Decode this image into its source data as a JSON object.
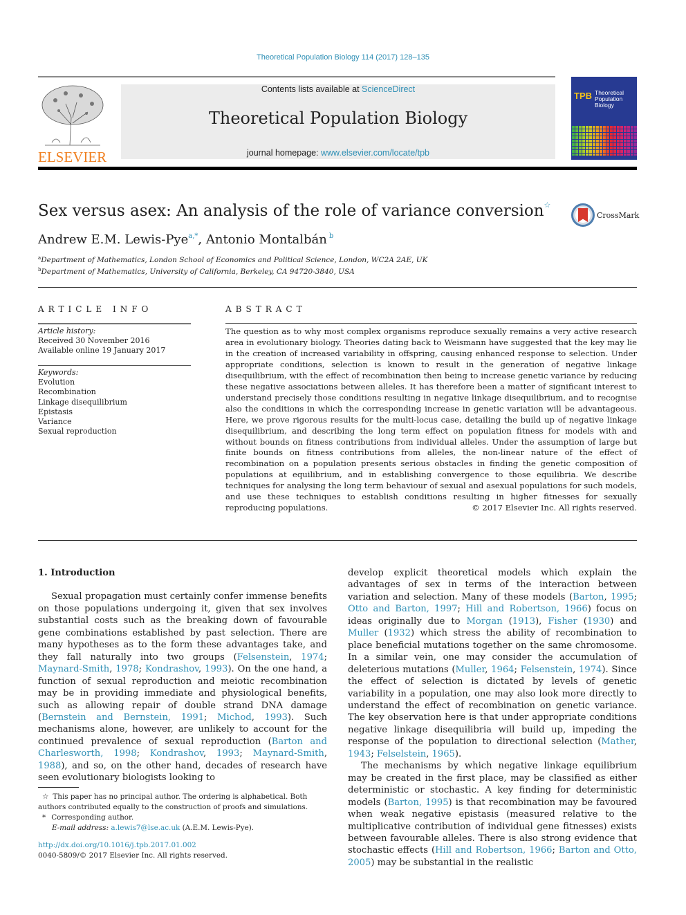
{
  "header": {
    "citation": "Theoretical Population Biology 114 (2017) 128–135",
    "contents_prefix": "Contents lists available at ",
    "contents_link": "ScienceDirect",
    "journal_title": "Theoretical Population Biology",
    "homepage_prefix": "journal homepage: ",
    "homepage_link": "www.elsevier.com/locate/tpb",
    "publisher_logo_text": "ELSEVIER",
    "cover": {
      "abbrev": "TPB",
      "title_lines": [
        "Theoretical",
        "Population",
        "Biology"
      ]
    }
  },
  "article": {
    "title": "Sex versus asex: An analysis of the role of variance conversion",
    "title_note_mark": "☆",
    "crossmark_label": "CrossMark",
    "authors": [
      {
        "name": "Andrew E.M. Lewis-Pye",
        "marks": "a,*"
      },
      {
        "name": "Antonio Montalbán",
        "marks": "b"
      }
    ],
    "author_separator": ", ",
    "affiliations": [
      {
        "mark": "a",
        "text": "Department of Mathematics, London School of Economics and Political Science, London, WC2A 2AE, UK"
      },
      {
        "mark": "b",
        "text": "Department of Mathematics, University of California, Berkeley, CA 94720-3840, USA"
      }
    ]
  },
  "article_info": {
    "heading": "ARTICLE INFO",
    "history_label": "Article history:",
    "history": [
      "Received 30 November 2016",
      "Available online 19 January 2017"
    ],
    "keywords_label": "Keywords:",
    "keywords": [
      "Evolution",
      "Recombination",
      "Linkage disequilibrium",
      "Epistasis",
      "Variance",
      "Sexual reproduction"
    ]
  },
  "abstract": {
    "heading": "ABSTRACT",
    "text": "The question as to why most complex organisms reproduce sexually remains a very active research area in evolutionary biology. Theories dating back to Weismann have suggested that the key may lie in the creation of increased variability in offspring, causing enhanced response to selection. Under appropriate conditions, selection is known to result in the generation of negative linkage disequilibrium, with the effect of recombination then being to increase genetic variance by reducing these negative associations between alleles. It has therefore been a matter of significant interest to understand precisely those conditions resulting in negative linkage disequilibrium, and to recognise also the conditions in which the corresponding increase in genetic variation will be advantageous. Here, we prove rigorous results for the multi-locus case, detailing the build up of negative linkage disequilibrium, and describing the long term effect on population fitness for models with and without bounds on fitness contributions from individual alleles. Under the assumption of large but finite bounds on fitness contributions from alleles, the non-linear nature of the effect of recombination on a population presents serious obstacles in finding the genetic composition of populations at equilibrium, and in establishing convergence to those equilibria. We describe techniques for analysing the long term behaviour of sexual and asexual populations for such models, and use these techniques to establish conditions resulting in higher fitnesses for sexually reproducing populations.",
    "copyright": "© 2017 Elsevier Inc. All rights reserved."
  },
  "body": {
    "section_heading": "1.  Introduction",
    "left_paragraph": [
      {
        "t": "Sexual propagation must certainly confer immense benefits on those populations undergoing it, given that sex involves substantial costs such as the breaking down of favourable gene combinations established by past selection. There are many hypotheses as to the form these advantages take, and they fall naturally into two groups ("
      },
      {
        "l": "Felsenstein"
      },
      {
        "t": ", "
      },
      {
        "l": "1974"
      },
      {
        "t": "; "
      },
      {
        "l": "Maynard-Smith"
      },
      {
        "t": ", "
      },
      {
        "l": "1978"
      },
      {
        "t": "; "
      },
      {
        "l": "Kondrashov"
      },
      {
        "t": ", "
      },
      {
        "l": "1993"
      },
      {
        "t": "). On the one hand, a function of sexual reproduction and meiotic recombination may be in providing immediate and physiological benefits, such as allowing repair of double strand DNA damage ("
      },
      {
        "l": "Bernstein and Bernstein, 1991"
      },
      {
        "t": "; "
      },
      {
        "l": "Michod"
      },
      {
        "t": ", "
      },
      {
        "l": "1993"
      },
      {
        "t": "). Such mechanisms alone, however, are unlikely to account for the continued prevalence of sexual reproduction ("
      },
      {
        "l": "Barton and Charlesworth, 1998"
      },
      {
        "t": "; "
      },
      {
        "l": "Kondrashov"
      },
      {
        "t": ", "
      },
      {
        "l": "1993"
      },
      {
        "t": "; "
      },
      {
        "l": "Maynard-Smith"
      },
      {
        "t": ", "
      },
      {
        "l": "1988"
      },
      {
        "t": "), and so, on the other hand, decades of research have seen evolutionary biologists looking to"
      }
    ],
    "right_paragraph_1": [
      {
        "t": "develop explicit theoretical models which explain the advantages of sex in terms of the interaction between variation and selection. Many of these models ("
      },
      {
        "l": "Barton"
      },
      {
        "t": ", "
      },
      {
        "l": "1995"
      },
      {
        "t": "; "
      },
      {
        "l": "Otto and Barton, 1997"
      },
      {
        "t": "; "
      },
      {
        "l": "Hill and Robertson, 1966"
      },
      {
        "t": ") focus on ideas originally due to "
      },
      {
        "l": "Morgan"
      },
      {
        "t": " ("
      },
      {
        "l": "1913"
      },
      {
        "t": "), "
      },
      {
        "l": "Fisher"
      },
      {
        "t": " ("
      },
      {
        "l": "1930"
      },
      {
        "t": ") and "
      },
      {
        "l": "Muller"
      },
      {
        "t": " ("
      },
      {
        "l": "1932"
      },
      {
        "t": ") which stress the ability of recombination to place beneficial mutations together on the same chromosome. In a similar vein, one may consider the accumulation of deleterious mutations ("
      },
      {
        "l": "Muller"
      },
      {
        "t": ", "
      },
      {
        "l": "1964"
      },
      {
        "t": "; "
      },
      {
        "l": "Felsenstein"
      },
      {
        "t": ", "
      },
      {
        "l": "1974"
      },
      {
        "t": "). Since the effect of selection is dictated by levels of genetic variability in a population, one may also look more directly to understand the effect of recombination on genetic variance. The key observation here is that under appropriate conditions negative linkage disequilibria will build up, impeding the response of the population to directional selection ("
      },
      {
        "l": "Mather"
      },
      {
        "t": ", "
      },
      {
        "l": "1943"
      },
      {
        "t": "; "
      },
      {
        "l": "Felselstein"
      },
      {
        "t": ", "
      },
      {
        "l": "1965"
      },
      {
        "t": ")."
      }
    ],
    "right_paragraph_2": [
      {
        "t": "The mechanisms by which negative linkage equilibrium may be created in the first place, may be classified as either deterministic or stochastic. A key finding for deterministic models ("
      },
      {
        "l": "Barton, 1995"
      },
      {
        "t": ") is that recombination may be favoured when weak negative epistasis (measured relative to the multiplicative contribution of individual gene fitnesses) exists between favourable alleles. There is also strong evidence that stochastic effects ("
      },
      {
        "l": "Hill and Robertson, 1966"
      },
      {
        "t": "; "
      },
      {
        "l": "Barton and Otto, 2005"
      },
      {
        "t": ") may be substantial in the realistic"
      }
    ]
  },
  "footnotes": {
    "star_mark": "☆",
    "star_text": "This paper has no principal author. The ordering is alphabetical. Both authors contributed equally to the construction of proofs and simulations.",
    "corresponding_mark": "*",
    "corresponding_text": "Corresponding author.",
    "email_label": "E-mail address:",
    "email": "a.lewis7@lse.ac.uk",
    "email_suffix": " (A.E.M. Lewis-Pye).",
    "doi": "http://dx.doi.org/10.1016/j.tpb.2017.01.002",
    "issn_line": "0040-5809/© 2017 Elsevier Inc. All rights reserved."
  },
  "colors": {
    "link": "#2e8fb5",
    "elsevier_orange": "#f07f1f",
    "banner_bg": "#ececec",
    "cover_blue": "#273a92"
  }
}
